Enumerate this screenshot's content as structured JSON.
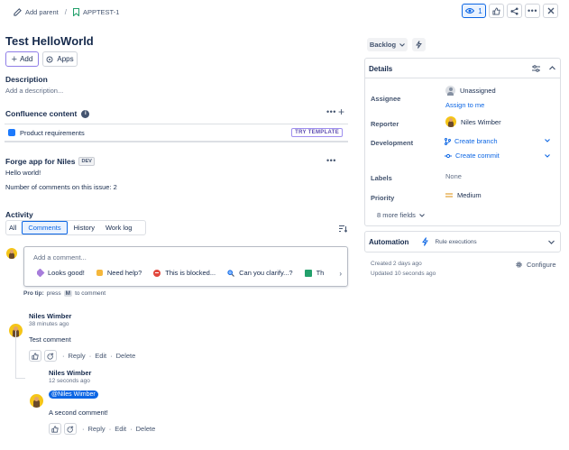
{
  "breadcrumb": {
    "add_parent": "Add parent",
    "separator": "/",
    "issue_key": "APPTEST-1"
  },
  "topbar": {
    "watch_count": "1"
  },
  "issue": {
    "title": "Test HelloWorld"
  },
  "actions": {
    "add": "Add",
    "apps": "Apps"
  },
  "description": {
    "heading": "Description",
    "placeholder": "Add a description..."
  },
  "confluence": {
    "heading": "Confluence content",
    "item": "Product requirements",
    "badge": "TRY TEMPLATE"
  },
  "forge": {
    "heading": "Forge app for Niles",
    "badge": "DEV",
    "line1": "Hello world!",
    "line2": "Number of comments on this issue: 2"
  },
  "activity": {
    "heading": "Activity",
    "tabs": [
      "All",
      "Comments",
      "History",
      "Work log"
    ],
    "active_tab": "Comments",
    "comment_placeholder": "Add a comment...",
    "quick_replies": [
      "Looks good!",
      "Need help?",
      "This is blocked...",
      "Can you clarify...?",
      "Th"
    ],
    "pro_tip": {
      "label": "Pro tip:",
      "press": "press",
      "key": "M",
      "suffix": "to comment"
    }
  },
  "comments": [
    {
      "author": "Niles Wimber",
      "time": "38 minutes ago",
      "body": "Test comment",
      "actions": [
        "Reply",
        "Edit",
        "Delete"
      ]
    },
    {
      "author": "Niles Wimber",
      "time": "12 seconds ago",
      "mention": "@Niles Wimber",
      "body": "A second comment!",
      "actions": [
        "Reply",
        "Edit",
        "Delete"
      ]
    }
  ],
  "status": {
    "label": "Backlog"
  },
  "details": {
    "heading": "Details",
    "fields": [
      {
        "label": "Assignee",
        "value": "Unassigned",
        "link": "Assign to me"
      },
      {
        "label": "Reporter",
        "value": "Niles Wimber"
      },
      {
        "label": "Development",
        "value": "Create branch",
        "link": "Create commit"
      },
      {
        "label": "Labels",
        "value": "None"
      },
      {
        "label": "Priority",
        "value": "Medium"
      }
    ],
    "more_fields": "8 more fields"
  },
  "automation": {
    "heading": "Automation",
    "sub": "Rule executions"
  },
  "meta": {
    "created": "Created 2 days ago",
    "updated": "Updated 10 seconds ago",
    "configure": "Configure"
  },
  "colors": {
    "brand": "#0c66e4",
    "selected": "#e9f2ff",
    "add_border": "#8f7ee7",
    "priority": "#e2a33a"
  }
}
